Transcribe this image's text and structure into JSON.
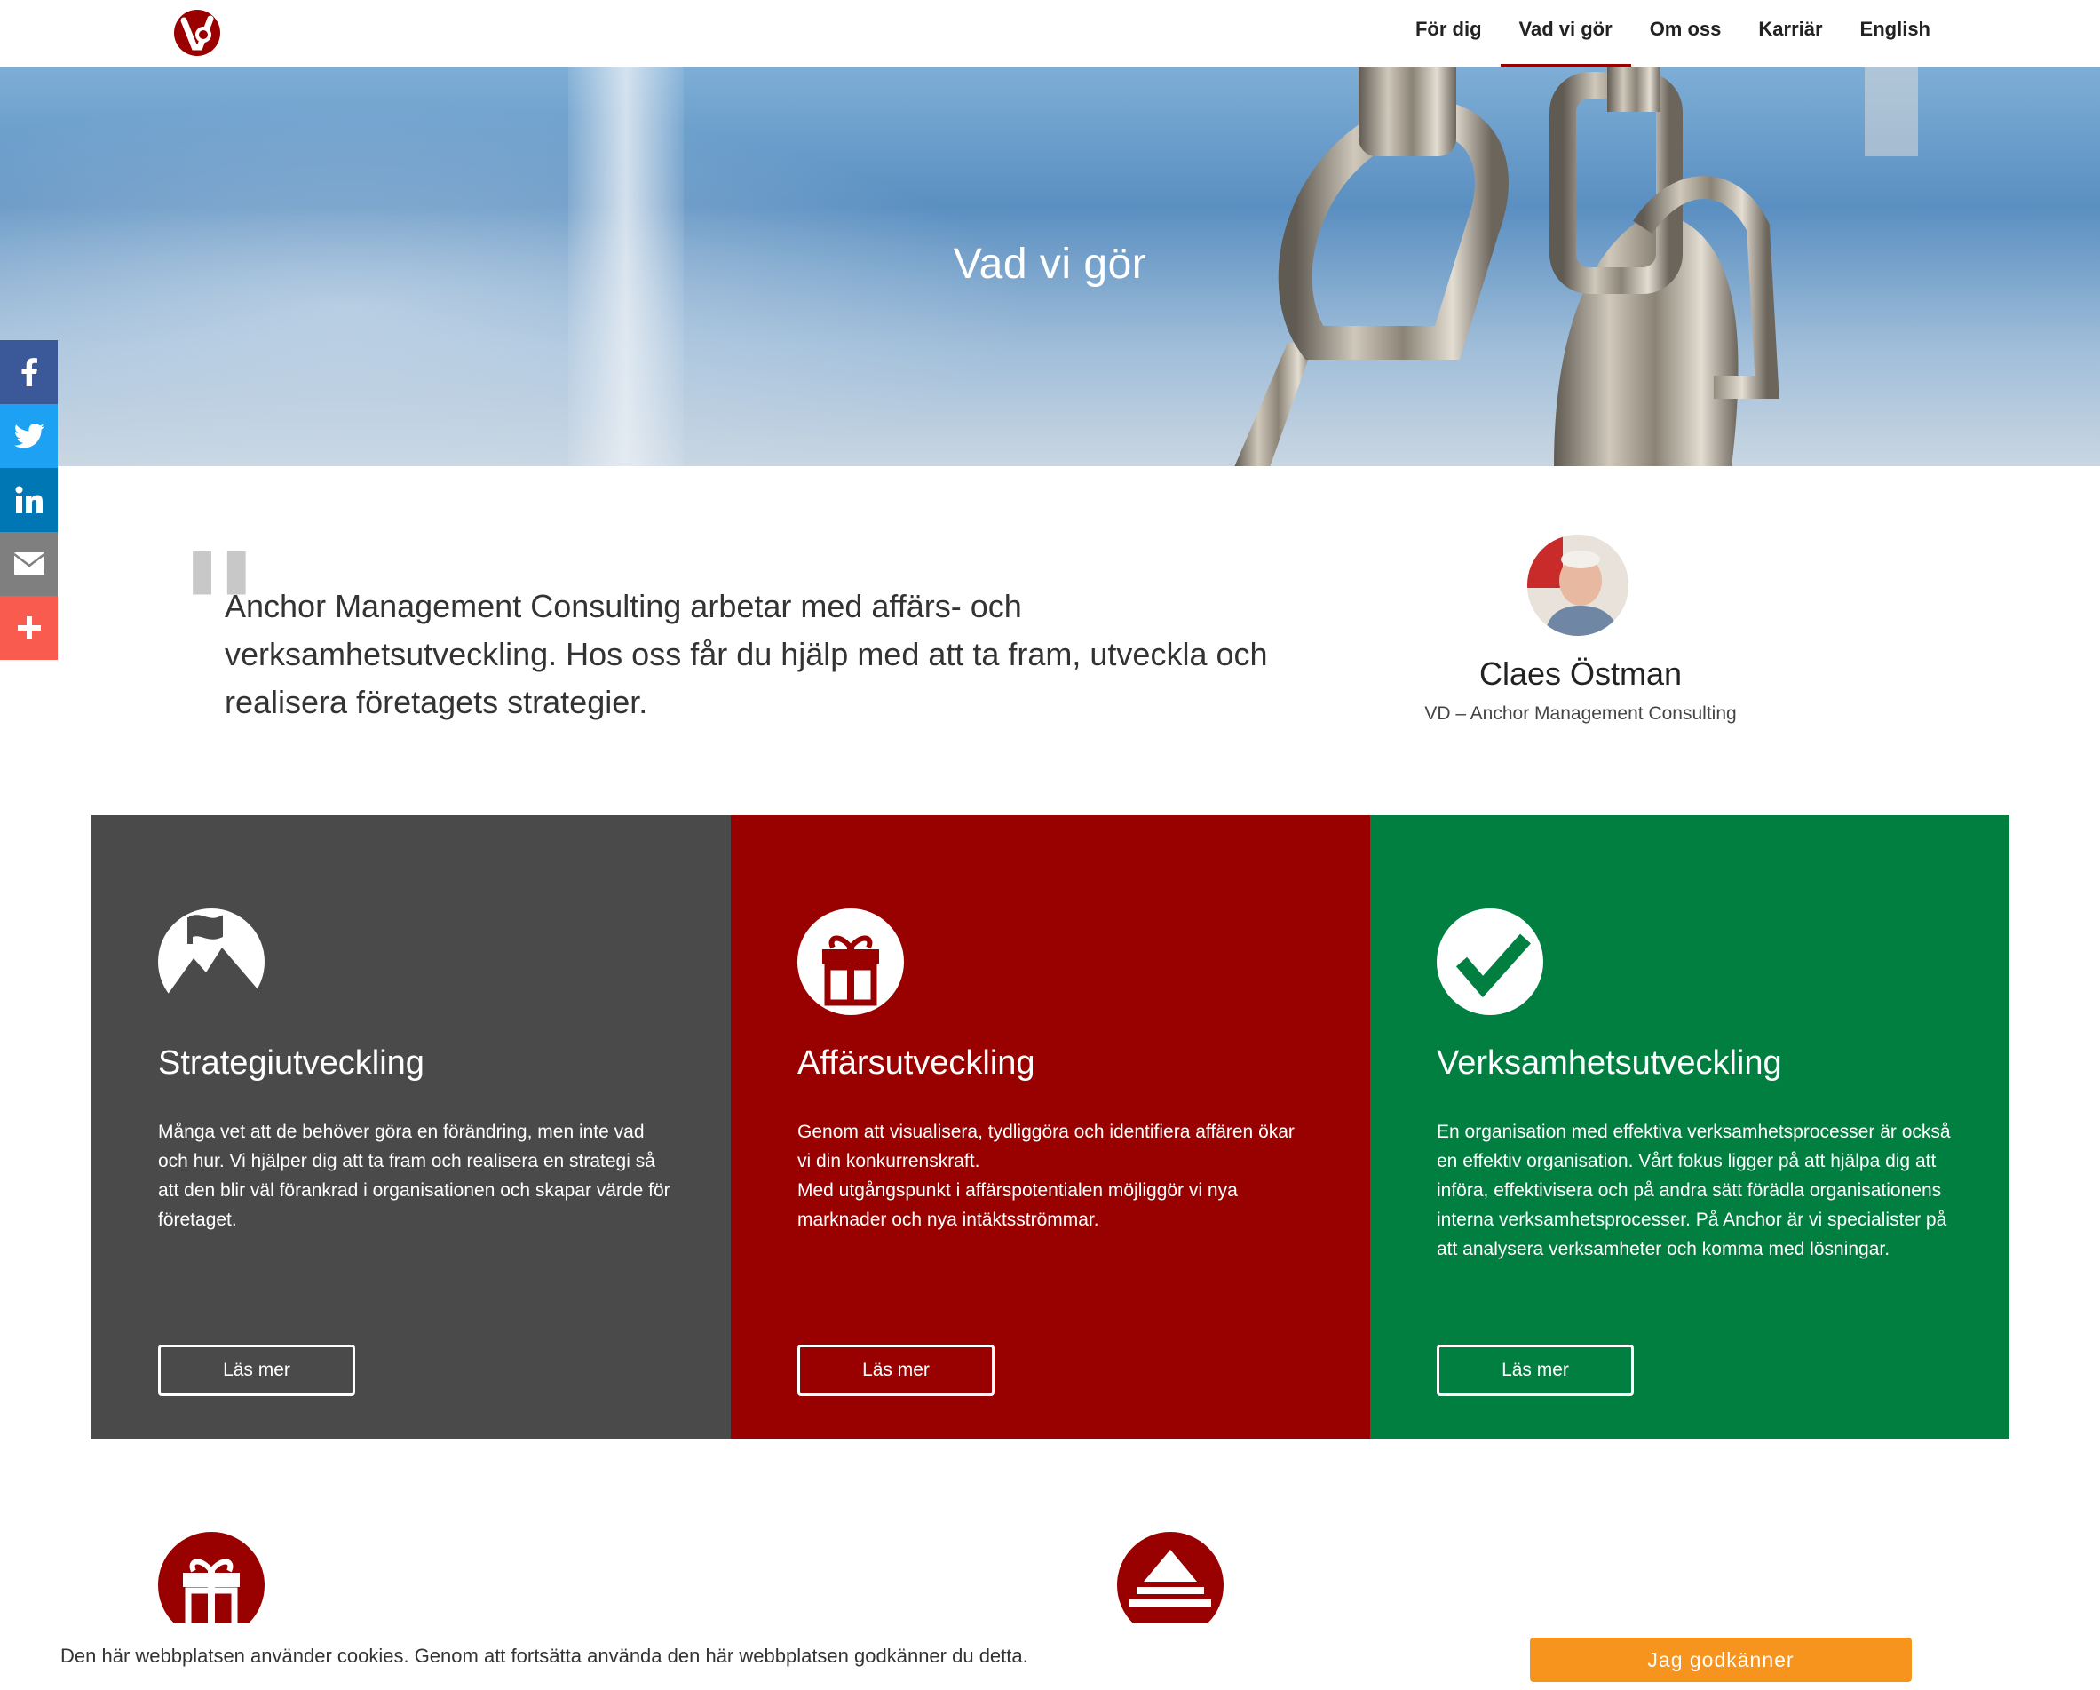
{
  "header": {
    "logo_icon": "anchor-logo-icon",
    "nav": [
      {
        "label": "För dig"
      },
      {
        "label": "Vad vi gör",
        "active": true
      },
      {
        "label": "Om oss"
      },
      {
        "label": "Karriär"
      },
      {
        "label": "English"
      }
    ]
  },
  "hero": {
    "title": "Vad vi gör"
  },
  "social": [
    {
      "icon": "facebook-icon",
      "color": "#3b5998"
    },
    {
      "icon": "twitter-icon",
      "color": "#1da1f2"
    },
    {
      "icon": "linkedin-icon",
      "color": "#0077b5"
    },
    {
      "icon": "email-icon",
      "color": "#7f7f7f"
    },
    {
      "icon": "share-plus-icon",
      "color": "#f95c4e"
    }
  ],
  "quote": {
    "text": "Anchor Management Consulting arbetar med affärs- och verksamhetsutveckling. Hos oss får du hjälp med att ta fram, utveckla och realisera företagets strategier.",
    "name": "Claes Östman",
    "role": "VD – Anchor Management Consulting"
  },
  "cards": [
    {
      "title": "Strategiutveckling",
      "body": "Många vet att de behöver göra en förändring, men inte vad och hur. Vi hjälper dig att ta fram och realisera en strategi så att den blir väl förankrad i organisationen och skapar värde för företaget.",
      "button": "Läs mer",
      "icon": "mountain-flag-icon",
      "color": "#4a4a4a"
    },
    {
      "title": "Affärsutveckling",
      "body": "Genom att visualisera, tydliggöra och identifiera affären ökar vi din konkurrenskraft.\nMed utgångspunkt i affärspotentialen möjliggör vi nya marknader och nya intäktsströmmar.",
      "button": "Läs mer",
      "icon": "gift-icon",
      "color": "#990000"
    },
    {
      "title": "Verksamhetsutveckling",
      "body": "En organisation med effektiva verksamhetsprocesser är också en effektiv organisation. Vårt fokus ligger på att hjälpa dig att införa, effektivisera och på andra sätt förädla organisationens interna verksamhetsprocesser. På Anchor är vi specialister på att analysera verksamheter och komma med lösningar.",
      "button": "Läs mer",
      "icon": "checkmark-icon",
      "color": "#007f40"
    }
  ],
  "lower_icons": [
    "gift-icon",
    "pyramid-icon"
  ],
  "cookie": {
    "text": "Den här webbplatsen använder cookies. Genom att fortsätta använda den här webbplatsen godkänner du detta.",
    "button": "Jag godkänner"
  }
}
